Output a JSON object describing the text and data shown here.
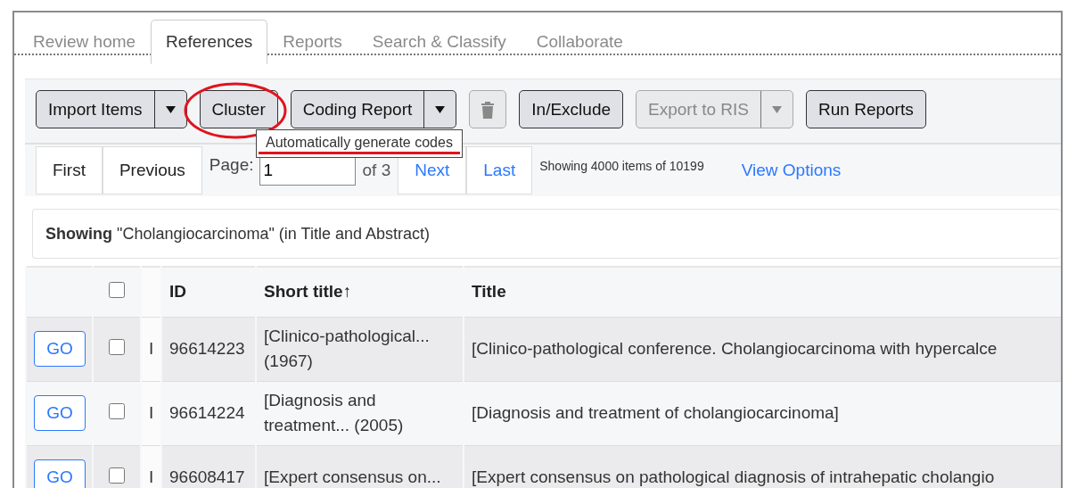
{
  "tabs": [
    {
      "label": "Review home",
      "selected": false
    },
    {
      "label": "References",
      "selected": true
    },
    {
      "label": "Reports",
      "selected": false
    },
    {
      "label": "Search & Classify",
      "selected": false
    },
    {
      "label": "Collaborate",
      "selected": false
    }
  ],
  "toolbar": {
    "buttons": [
      {
        "kind": "split",
        "label": "Import Items",
        "disabled": false,
        "circled": false
      },
      {
        "kind": "plain",
        "label": "Cluster",
        "disabled": false,
        "circled": true
      },
      {
        "kind": "split",
        "label": "Coding Report",
        "disabled": false,
        "circled": false
      },
      {
        "kind": "icon",
        "disabled": true,
        "circled": false
      },
      {
        "kind": "plain",
        "label": "In/Exclude",
        "disabled": false,
        "circled": false
      },
      {
        "kind": "split",
        "label": "Export to RIS",
        "disabled": true,
        "circled": false
      },
      {
        "kind": "plain",
        "label": "Run Reports",
        "disabled": false,
        "circled": false
      }
    ]
  },
  "tooltip": {
    "text": "Automatically generate codes",
    "underlined": true
  },
  "pager": {
    "first": "First",
    "previous": "Previous",
    "page_label": "Page:",
    "page_value": "1",
    "page_count": "of 3",
    "next": "Next",
    "last": "Last",
    "summary": "Showing 4000 items of 10199",
    "view_options": "View Options"
  },
  "filter": {
    "text": "**Showing** \"Cholangiocarcinoma\" (in Title and Abstract)"
  },
  "table": {
    "header_checkbox": {
      "checked": false
    },
    "columns": [
      "ID",
      "Short title↑",
      "Title"
    ],
    "rows": [
      {
        "go": "GO",
        "checked": false,
        "flag": "I",
        "id": "96614223",
        "short_title": "[Clinico-pathological... (1967)",
        "title": "[Clinico-pathological conference. Cholangiocarcinoma with hypercalce"
      },
      {
        "go": "GO",
        "checked": false,
        "flag": "I",
        "id": "96614224",
        "short_title": "[Diagnosis and treatment... (2005)",
        "title": "[Diagnosis and treatment of cholangiocarcinoma]"
      },
      {
        "go": "GO",
        "checked": false,
        "flag": "I",
        "id": "96608417",
        "short_title": "[Expert consensus on...",
        "title": "[Expert consensus on pathological diagnosis of intrahepatic cholangio"
      }
    ]
  }
}
